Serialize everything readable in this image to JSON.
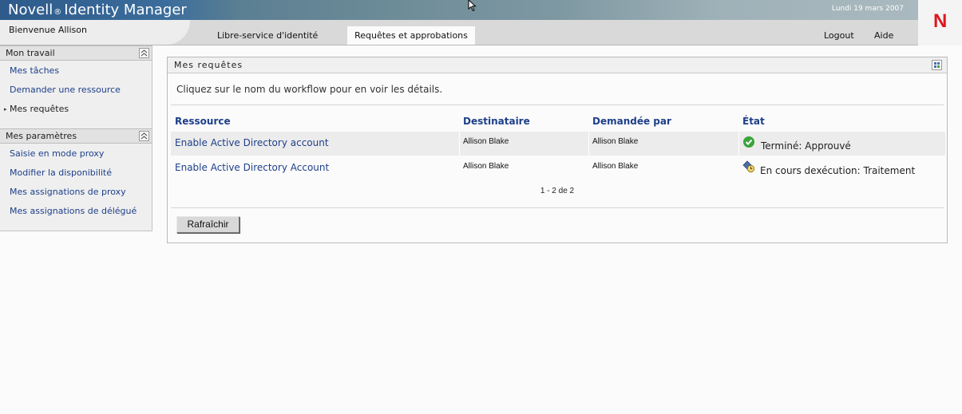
{
  "header": {
    "app_name": "Novell",
    "app_reg": "®",
    "app_product": "Identity Manager",
    "date": "Lundi 19 mars 2007",
    "welcome": "Bienvenue Allison",
    "tabs": [
      {
        "label": "Libre-service d'identité",
        "active": false
      },
      {
        "label": "Requêtes et approbations",
        "active": true
      }
    ],
    "links": {
      "logout": "Logout",
      "help": "Aide"
    },
    "logo_letter": "N",
    "brand_color": "#e0171e"
  },
  "sidebar": {
    "sections": [
      {
        "title": "Mon travail",
        "items": [
          {
            "label": "Mes tâches",
            "current": false
          },
          {
            "label": "Demander une ressource",
            "current": false
          },
          {
            "label": "Mes requêtes",
            "current": true
          }
        ]
      },
      {
        "title": "Mes paramètres",
        "items": [
          {
            "label": "Saisie en mode proxy",
            "current": false
          },
          {
            "label": "Modifier la disponibilité",
            "current": false
          },
          {
            "label": "Mes assignations de proxy",
            "current": false
          },
          {
            "label": "Mes assignations de délégué",
            "current": false
          }
        ]
      }
    ]
  },
  "main": {
    "panel_title": "Mes requêtes",
    "instruction": "Cliquez sur le nom du workflow pour en voir les détails.",
    "columns": [
      "Ressource",
      "Destinataire",
      "Demandée par",
      "État"
    ],
    "rows": [
      {
        "resource": "Enable Active Directory account",
        "recipient": "Allison Blake",
        "requested_by": "Allison Blake",
        "state": "Terminé: Approuvé",
        "state_icon": "check-circle-icon"
      },
      {
        "resource": "Enable Active Directory Account",
        "recipient": "Allison Blake",
        "requested_by": "Allison Blake",
        "state": "En cours dexécution: Traitement",
        "state_icon": "running-clock-icon"
      }
    ],
    "pager": "1 - 2 de 2",
    "refresh_button": "Rafraîchir"
  },
  "colors": {
    "link": "#1d3f8a",
    "header_blue": "#2d5a8a",
    "ok_green": "#3aa33a"
  }
}
